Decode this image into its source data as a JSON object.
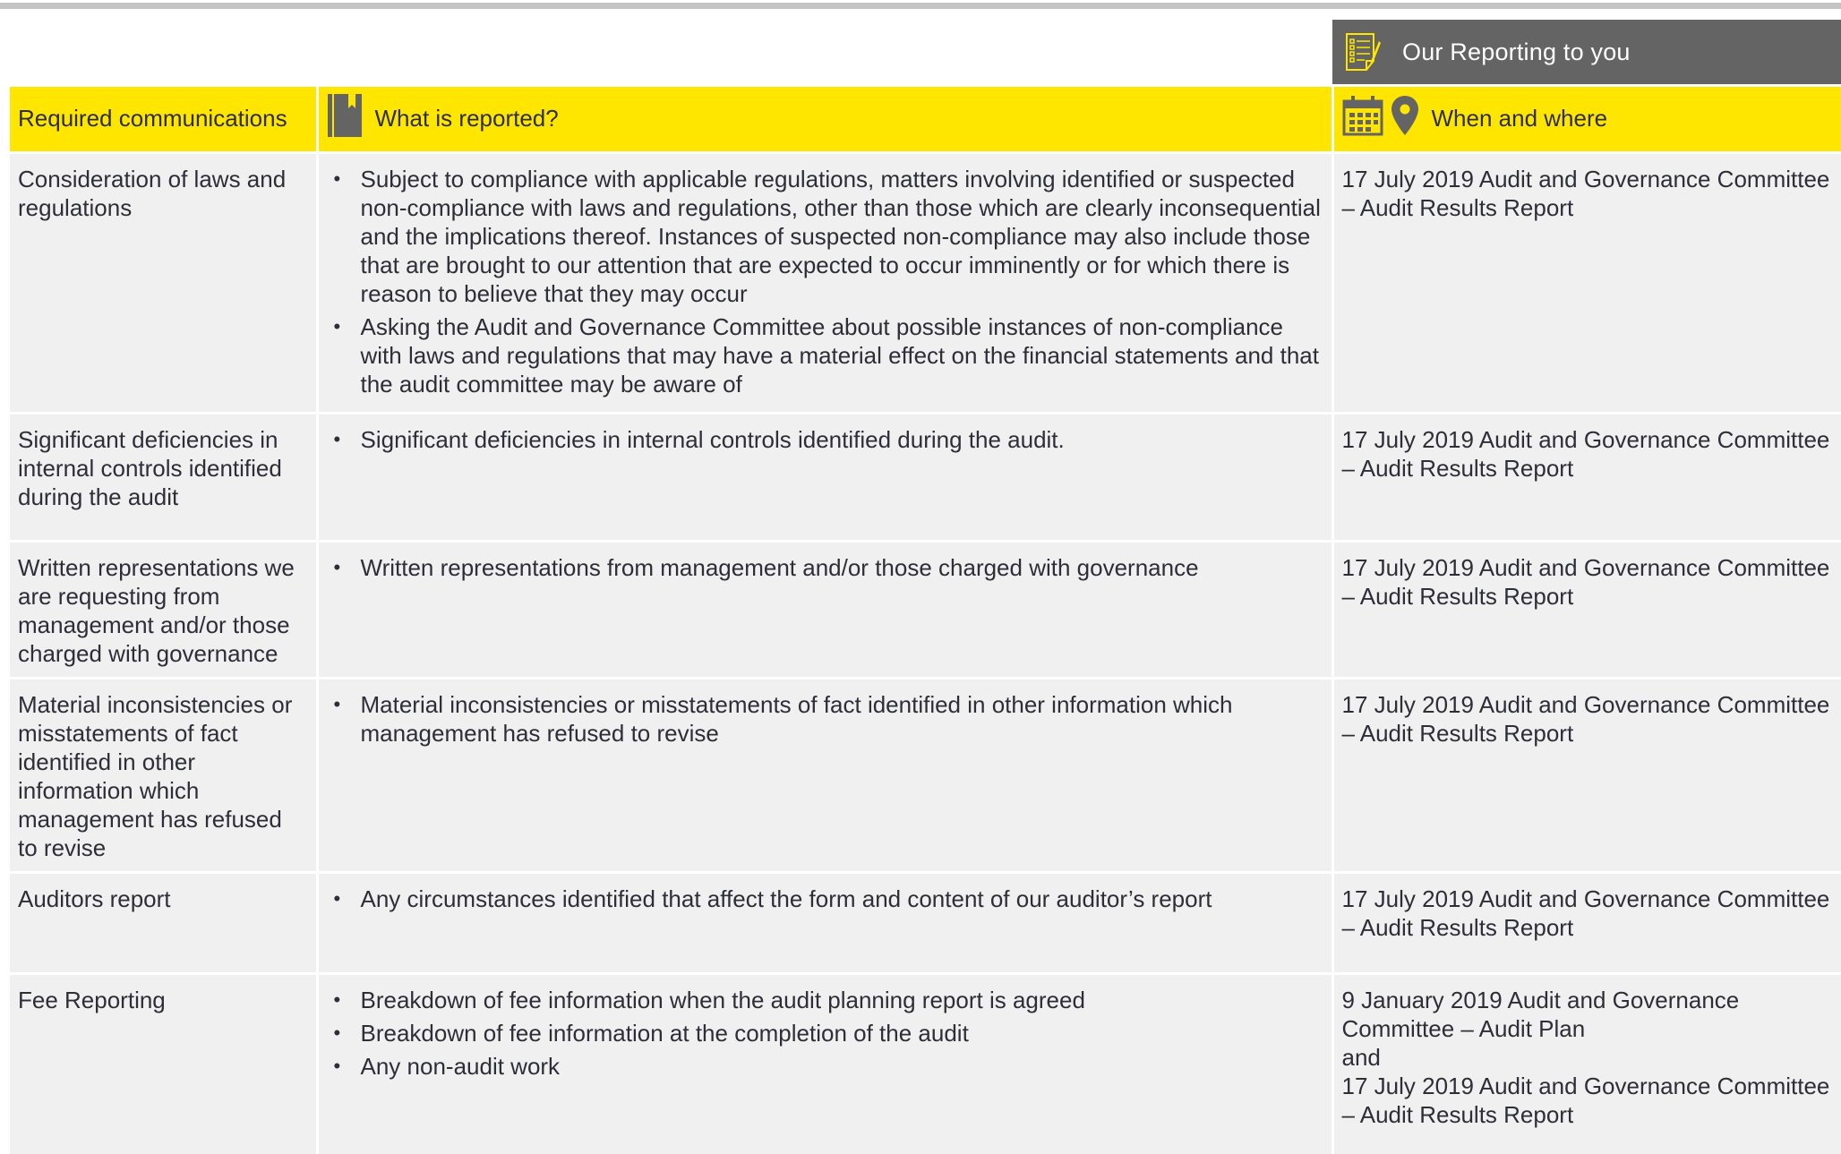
{
  "banner": {
    "title": "Our Reporting to you",
    "background": "#646464",
    "icon": "report-checklist-icon"
  },
  "header": {
    "background": "#ffe600",
    "col1": "Required communications",
    "col2": "What is reported?",
    "col2_icon": "notebook-icon",
    "col3": "When and where",
    "col3_icons": [
      "calendar-icon",
      "location-pin-icon"
    ]
  },
  "rows": [
    {
      "required": "Consideration of laws and regulations",
      "reported": [
        "Subject to compliance with applicable regulations, matters involving identified or suspected non-compliance with laws and regulations, other than those which are clearly inconsequential and the implications thereof. Instances of suspected non-compliance may also include those that are brought to our attention that are expected to occur imminently or for which there is reason to believe that they may occur",
        "Asking the Audit and Governance Committee about possible instances of non-compliance with laws and regulations that may have a material effect on the financial statements and that the audit committee may be aware of"
      ],
      "when": [
        "17 July 2019 Audit and Governance Committee – Audit Results Report"
      ]
    },
    {
      "required": "Significant deficiencies in internal controls identified during the audit",
      "reported": [
        "Significant deficiencies in internal controls identified during the audit."
      ],
      "when": [
        "17 July 2019 Audit and Governance Committee – Audit Results Report"
      ]
    },
    {
      "required": "Written representations we are requesting from management and/or those charged with governance",
      "reported": [
        "Written representations from management and/or those charged with governance"
      ],
      "when": [
        "17 July 2019 Audit and Governance Committee – Audit Results Report"
      ]
    },
    {
      "required": "Material inconsistencies or misstatements of fact identified in other information which management has refused to revise",
      "reported": [
        "Material inconsistencies or misstatements of fact identified in other information which management has refused to revise"
      ],
      "when": [
        "17 July 2019 Audit and Governance Committee – Audit Results Report"
      ]
    },
    {
      "required": "Auditors report",
      "reported": [
        "Any circumstances identified that affect the form and content of our auditor’s report"
      ],
      "when": [
        "17 July 2019 Audit and Governance Committee – Audit Results Report"
      ]
    },
    {
      "required": "Fee Reporting",
      "reported": [
        "Breakdown of fee information when the  audit planning report is agreed",
        "Breakdown of fee information at the completion of the audit",
        "Any non-audit work"
      ],
      "when": [
        "9 January 2019 Audit and Governance Committee – Audit Plan",
        "and",
        "17 July 2019  Audit and Governance Committee – Audit Results Report"
      ]
    }
  ]
}
